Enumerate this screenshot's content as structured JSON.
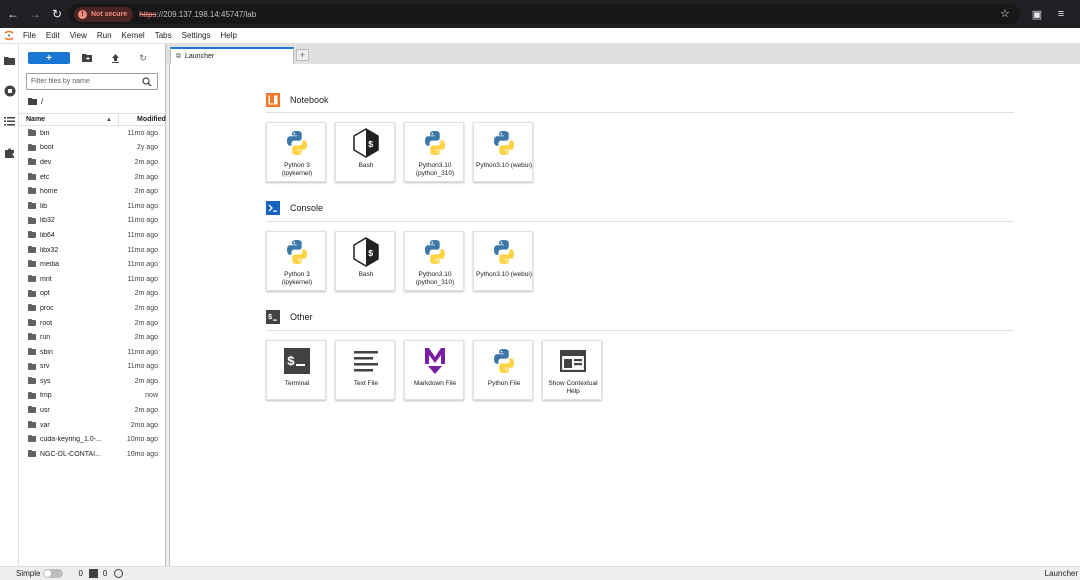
{
  "browser": {
    "security_label": "Not secure",
    "url_protocol": "https",
    "url_rest": "://209.137.198.14:45747/lab"
  },
  "menu": [
    "File",
    "Edit",
    "View",
    "Run",
    "Kernel",
    "Tabs",
    "Settings",
    "Help"
  ],
  "file_browser": {
    "new_label": "+",
    "filter_placeholder": "Filter files by name",
    "breadcrumb": "/",
    "col_name": "Name",
    "col_modified": "Modified",
    "files": [
      {
        "name": "bin",
        "modified": "11mo ago"
      },
      {
        "name": "boot",
        "modified": "2y ago"
      },
      {
        "name": "dev",
        "modified": "2m ago"
      },
      {
        "name": "etc",
        "modified": "2m ago"
      },
      {
        "name": "home",
        "modified": "2m ago"
      },
      {
        "name": "lib",
        "modified": "11mo ago"
      },
      {
        "name": "lib32",
        "modified": "11mo ago"
      },
      {
        "name": "lib64",
        "modified": "11mo ago"
      },
      {
        "name": "libx32",
        "modified": "11mo ago"
      },
      {
        "name": "media",
        "modified": "11mo ago"
      },
      {
        "name": "mnt",
        "modified": "11mo ago"
      },
      {
        "name": "opt",
        "modified": "2m ago"
      },
      {
        "name": "proc",
        "modified": "2m ago"
      },
      {
        "name": "root",
        "modified": "2m ago"
      },
      {
        "name": "run",
        "modified": "2m ago"
      },
      {
        "name": "sbin",
        "modified": "11mo ago"
      },
      {
        "name": "srv",
        "modified": "11mo ago"
      },
      {
        "name": "sys",
        "modified": "2m ago"
      },
      {
        "name": "tmp",
        "modified": "now"
      },
      {
        "name": "usr",
        "modified": "2m ago"
      },
      {
        "name": "var",
        "modified": "2mo ago"
      },
      {
        "name": "cuda-keyring_1.0-...",
        "modified": "10mo ago"
      },
      {
        "name": "NGC-DL-CONTAI...",
        "modified": "10mo ago"
      }
    ]
  },
  "tab": {
    "label": "Launcher"
  },
  "launcher": {
    "notebook": {
      "title": "Notebook",
      "cards": [
        {
          "label": "Python 3 (ipykernel)",
          "icon": "python-icon"
        },
        {
          "label": "Bash",
          "icon": "bash-icon"
        },
        {
          "label": "Python3.10 (python_310)",
          "icon": "python-icon"
        },
        {
          "label": "Python3.10 (webui)",
          "icon": "python-icon"
        }
      ]
    },
    "console": {
      "title": "Console",
      "cards": [
        {
          "label": "Python 3 (ipykernel)",
          "icon": "python-icon"
        },
        {
          "label": "Bash",
          "icon": "bash-icon"
        },
        {
          "label": "Python3.10 (python_310)",
          "icon": "python-icon"
        },
        {
          "label": "Python3.10 (webui)",
          "icon": "python-icon"
        }
      ]
    },
    "other": {
      "title": "Other",
      "cards": [
        {
          "label": "Terminal",
          "icon": "terminal-icon"
        },
        {
          "label": "Text File",
          "icon": "text-file-icon"
        },
        {
          "label": "Markdown File",
          "icon": "markdown-icon"
        },
        {
          "label": "Python File",
          "icon": "python-icon"
        },
        {
          "label": "Show Contextual Help",
          "icon": "contextual-help-icon"
        }
      ]
    }
  },
  "status": {
    "mode": "Simple",
    "kernels": "0",
    "terminals": "0",
    "right": "Launcher"
  },
  "colors": {
    "accent": "#1976d2",
    "notebook_icon": "#f37726",
    "python_blue": "#3b77a8",
    "python_yellow": "#ffd343",
    "markdown_purple": "#7b1fa2"
  }
}
